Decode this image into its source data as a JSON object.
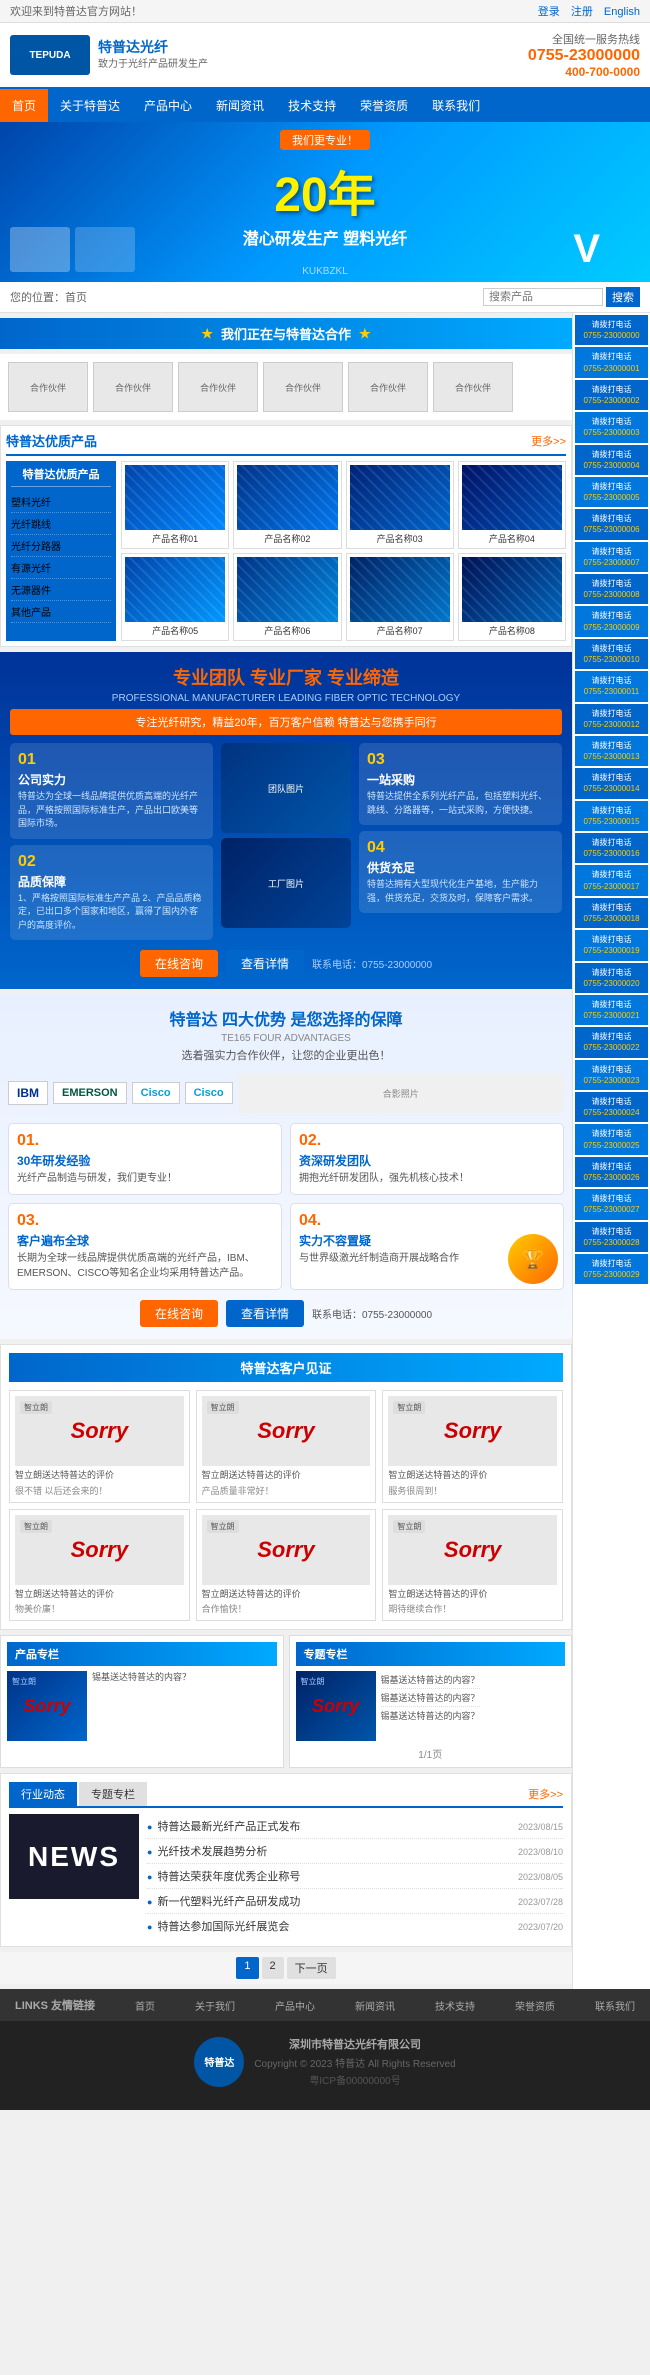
{
  "topBar": {
    "left": "欢迎来到特普达官方网站！",
    "right_login": "登录",
    "right_register": "注册",
    "right_english": "English"
  },
  "header": {
    "logo_text": "TEPUDA",
    "slogan_line1": "特普达光纤",
    "slogan_line2": "致力于光纤产品研发生产",
    "contact_text": "全国统一服务热线",
    "phone": "0755-23000000",
    "phone2": "400-700-0000"
  },
  "nav": {
    "items": [
      "首页",
      "关于特普达",
      "产品中心",
      "新闻资讯",
      "技术支持",
      "荣誉资质",
      "联系我们"
    ]
  },
  "banner": {
    "badge": "我们更专业！",
    "year": "20年",
    "title": "潜心研发生产 塑料光纤",
    "subtitle": "KUKBZKL"
  },
  "breadcrumb": {
    "home": "您的位置：首页",
    "search_placeholder": "搜索产品"
  },
  "sectionTitles": {
    "cooperation": "我们正在与特普达合作",
    "featured_products": "特普达优质产品",
    "team": "专业团队 专业厂家 专业缔造",
    "team_sub": "PROFESSIONAL MANUFACTURER LEADING FIBER OPTIC TECHNOLOGY",
    "team_desc": "专注光纤研究，精益20年，百万客户信赖 特普达与您携手同行",
    "advantages": "特普达 四大优势 是您选择的保障",
    "advantages_sub": "TE165 FOUR ADVANTAGES",
    "advantages_desc": "选着强实力合作伙伴，让您的企业更出色！",
    "customers": "特普达客户见证",
    "news": "行业动态"
  },
  "featuredProducts": {
    "title": "特普达优质产品",
    "more": "更多>>",
    "leftMenu": {
      "title": "特普达优质产品",
      "items": [
        "塑料光纤",
        "光纤跳线",
        "光纤分路器",
        "有源光纤",
        "无源器件",
        "其他产品"
      ]
    },
    "products": [
      {
        "name": "产品名称01",
        "type": "fiber"
      },
      {
        "name": "产品名称02",
        "type": "fiber"
      },
      {
        "name": "产品名称03",
        "type": "fiber"
      },
      {
        "name": "产品名称04",
        "type": "fiber"
      },
      {
        "name": "产品名称05",
        "type": "fiber"
      },
      {
        "name": "产品名称06",
        "type": "fiber"
      },
      {
        "name": "产品名称07",
        "type": "fiber"
      },
      {
        "name": "产品名称08",
        "type": "fiber"
      }
    ]
  },
  "teamSection": {
    "title1": "专业团队",
    "title2": "专业厂家",
    "title3": "专业缔造",
    "sub": "PROFESSIONAL MANUFACTURER LEADING FIBER OPTIC TECHNOLOGY",
    "desc": "专注光纤研究，精益20年，百万客户信赖 特普达与您携手同行",
    "steps": [
      {
        "num": "01",
        "title": "公司实力",
        "text": "特普达为全球一线品牌提供优质高端的光纤产品，严格按照国际标准生产，产品出口欧美等国际市场。"
      },
      {
        "num": "02",
        "title": "品质保障",
        "text": "1、严格按照国际标准生产产品\n2、产品品质稳定，已出口多个国家和地区，赢得了国内外客户的高度评价。"
      },
      {
        "num": "03",
        "title": "一站采购",
        "text": "特普达提供全系列光纤产品，包括塑料光纤、跳线、分路器等，一站式采购，方便快捷。"
      },
      {
        "num": "04",
        "title": "供货充足",
        "text": "特普达拥有大型现代化生产基地，生产能力强，供货充足，交货及时，保障客户需求。"
      }
    ],
    "btn_inquiry": "在线咨询",
    "btn_more": "查看详情",
    "contact_info": "联系电话：0755-23000000"
  },
  "advantages": {
    "items": [
      {
        "num": "01.",
        "title": "30年研发经验",
        "text": "光纤产品制造与研发，我们更专业！"
      },
      {
        "num": "02.",
        "title": "资深研发团队",
        "text": "拥抱光纤研发团队，强先机核心技术！"
      },
      {
        "num": "03.",
        "title": "客户遍布全球",
        "text": "长期为全球一线品牌提供优质高端的光纤产品，IBM、EMERSON、CISCO等知名企业均采用特普达产品。"
      },
      {
        "num": "04.",
        "title": "实力不容置疑",
        "text": "与世界级激光纤制造商开展战略合作"
      }
    ],
    "btn_inquiry": "在线咨询",
    "btn_more": "查看详情",
    "contact": "联系电话：0755-23000000"
  },
  "partners": [
    "IBM",
    "EMERSON",
    "Cisco",
    "Cisco2"
  ],
  "customers": {
    "title": "特普达客户见证",
    "items": [
      {
        "company": "智立朗",
        "sorry": "Sorry",
        "desc": "智立朗送达特普达的评价",
        "detail": "很不错 以后还会来的！"
      },
      {
        "company": "智立朗",
        "sorry": "Sorry",
        "desc": "智立朗送达特普达的评价",
        "detail": "产品质量非常好！"
      },
      {
        "company": "智立朗",
        "sorry": "Sorry",
        "desc": "智立朗送达特普达的评价",
        "detail": "服务很周到！"
      },
      {
        "company": "智立朗",
        "sorry": "Sorry",
        "desc": "智立朗送达特普达的评价",
        "detail": "物美价廉！"
      },
      {
        "company": "智立朗",
        "sorry": "Sorry",
        "desc": "智立朗送达特普达的评价",
        "detail": "合作愉快！"
      },
      {
        "company": "智立朗",
        "sorry": "Sorry",
        "desc": "智立朗送达特普达的评价",
        "detail": "期待继续合作！"
      }
    ]
  },
  "newsSection": {
    "categories": [
      "行业动态",
      "专题专栏",
      "更多>>"
    ],
    "items": [
      {
        "date": "2023/08/15",
        "title": "特普达最新光纤产品正式发布",
        "img": "news"
      },
      {
        "date": "2023/08/10",
        "title": "光纤技术发展趋势分析"
      },
      {
        "date": "2023/08/05",
        "title": "特普达荣获年度优秀企业称号"
      },
      {
        "date": "2023/07/28",
        "title": "新一代塑料光纤产品研发成功"
      },
      {
        "date": "2023/07/20",
        "title": "特普达参加国际光纤展览会"
      }
    ],
    "news_img_text": "NEWS"
  },
  "sidebarContacts": [
    {
      "label": "请拨打电话",
      "phone": "0755-23000000"
    },
    {
      "label": "请拨打电话",
      "phone": "0755-23000001"
    },
    {
      "label": "请拨打电话",
      "phone": "0755-23000002"
    },
    {
      "label": "请拨打电话",
      "phone": "0755-23000003"
    },
    {
      "label": "请拨打电话",
      "phone": "0755-23000004"
    },
    {
      "label": "请拨打电话",
      "phone": "0755-23000005"
    },
    {
      "label": "请拨打电话",
      "phone": "0755-23000006"
    },
    {
      "label": "请拨打电话",
      "phone": "0755-23000007"
    },
    {
      "label": "请拨打电话",
      "phone": "0755-23000008"
    },
    {
      "label": "请拨打电话",
      "phone": "0755-23000009"
    },
    {
      "label": "请拨打电话",
      "phone": "0755-23000010"
    },
    {
      "label": "请拨打电话",
      "phone": "0755-23000011"
    },
    {
      "label": "请拨打电话",
      "phone": "0755-23000012"
    },
    {
      "label": "请拨打电话",
      "phone": "0755-23000013"
    },
    {
      "label": "请拨打电话",
      "phone": "0755-23000014"
    },
    {
      "label": "请拨打电话",
      "phone": "0755-23000015"
    },
    {
      "label": "请拨打电话",
      "phone": "0755-23000016"
    },
    {
      "label": "请拨打电话",
      "phone": "0755-23000017"
    },
    {
      "label": "请拨打电话",
      "phone": "0755-23000018"
    },
    {
      "label": "请拨打电话",
      "phone": "0755-23000019"
    },
    {
      "label": "请拨打电话",
      "phone": "0755-23000020"
    },
    {
      "label": "请拨打电话",
      "phone": "0755-23000021"
    },
    {
      "label": "请拨打电话",
      "phone": "0755-23000022"
    },
    {
      "label": "请拨打电话",
      "phone": "0755-23000023"
    },
    {
      "label": "请拨打电话",
      "phone": "0755-23000024"
    },
    {
      "label": "请拨打电话",
      "phone": "0755-23000025"
    },
    {
      "label": "请拨打电话",
      "phone": "0755-23000026"
    },
    {
      "label": "请拨打电话",
      "phone": "0755-23000027"
    },
    {
      "label": "请拨打电话",
      "phone": "0755-23000028"
    },
    {
      "label": "请拨打电话",
      "phone": "0755-23000029"
    }
  ],
  "footer": {
    "links_title": "LINKS 友情链接",
    "links": [
      "首页",
      "关于我们",
      "产品中心",
      "新闻资讯",
      "技术支持",
      "荣誉资质",
      "联系我们"
    ],
    "company": "深圳市特普达光纤有限公司",
    "copyright": "Copyright © 2023 特普达 All Rights Reserved",
    "icp": "粤ICP备00000000号",
    "logo_text": "特普达"
  }
}
